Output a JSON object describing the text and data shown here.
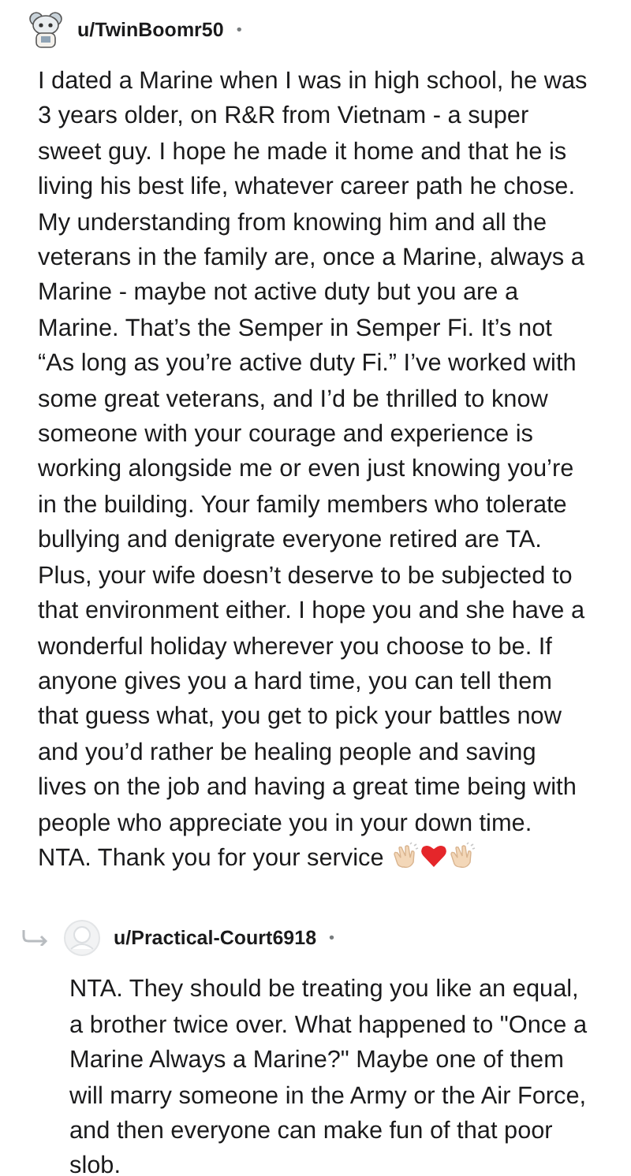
{
  "comments": [
    {
      "author": "u/TwinBoomr50",
      "separator": "•",
      "reply": false,
      "body": "I dated a Marine when I was in high school, he was 3 years older, on R&R from Vietnam - a super sweet guy. I hope he made it home and that he is living his best life, whatever career path he chose. My understanding from knowing him and all the veterans in the family are, once a Marine, always a Marine - maybe not active duty but you are a Marine. That’s the Semper in Semper Fi. It’s not “As long as you’re active duty Fi.” I’ve worked with some great veterans, and I’d be thrilled to know someone with your courage and experience is working alongside me or even just knowing you’re in the building. Your family members who tolerate bullying and denigrate everyone retired are TA. Plus, your wife doesn’t deserve to be subjected to that environment either. I hope you and she have a wonderful holiday wherever you choose to be. If anyone gives you a hard time, you can tell them that guess what, you get to pick your battles now and you’d rather be healing people and saving lives on the job and having a great time being with people who appreciate you in your down time. NTA. Thank you for your service",
      "emojis": [
        {
          "kind": "clap"
        },
        {
          "kind": "heart"
        },
        {
          "kind": "clap"
        }
      ]
    },
    {
      "author": "u/Practical-Court6918",
      "separator": "•",
      "reply": true,
      "body": "NTA. They should be treating you like an equal, a brother twice over. What happened to \"Once a Marine Always a Marine?\" Maybe one of them will marry someone in the Army or the Air Force, and then everyone can make fun of that poor slob."
    }
  ]
}
